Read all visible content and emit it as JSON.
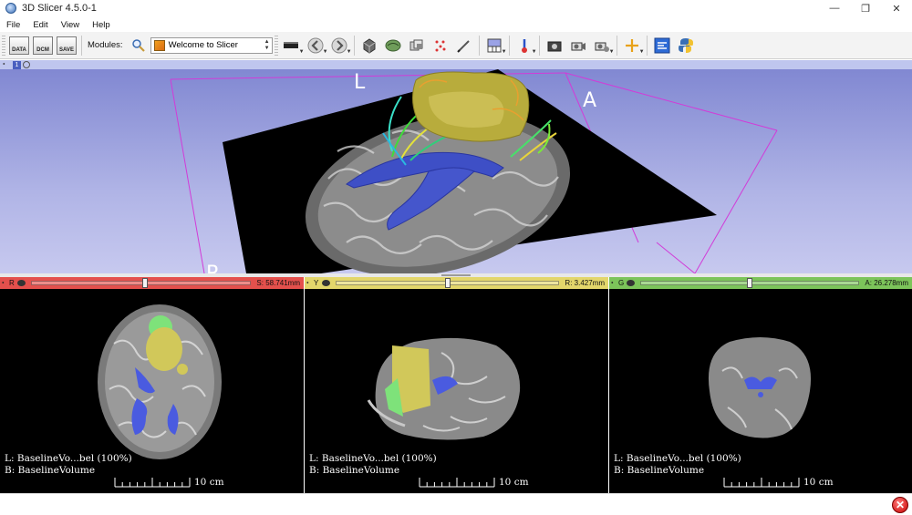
{
  "window": {
    "title": "3D Slicer 4.5.0-1",
    "minimize_glyph": "—",
    "restore_glyph": "❐",
    "close_glyph": "✕"
  },
  "menu": [
    "File",
    "Edit",
    "View",
    "Help"
  ],
  "toolbar": {
    "data_label": "DATA",
    "dcm_label": "DCM",
    "save_label": "SAVE",
    "modules_label": "Modules:",
    "module_selected": "Welcome to Slicer"
  },
  "view3d": {
    "number": "1",
    "orientation_L": "L",
    "orientation_A": "A",
    "orientation_R_partial": "R"
  },
  "slices": [
    {
      "id": "red",
      "letter": "R",
      "bar_color": "#e4504c",
      "offset": "S: 58.741mm",
      "slider_fraction": 0.52,
      "label_line": "L: BaselineVo...bel (100%)",
      "background_line": "B: BaselineVolume",
      "scale_label": "10 cm"
    },
    {
      "id": "yellow",
      "letter": "Y",
      "bar_color": "#e3d66b",
      "offset": "R: 3.427mm",
      "slider_fraction": 0.5,
      "label_line": "L: BaselineVo...bel (100%)",
      "background_line": "B: BaselineVolume",
      "scale_label": "10 cm"
    },
    {
      "id": "green",
      "letter": "G",
      "bar_color": "#7cc45a",
      "offset": "A: 26.278mm",
      "slider_fraction": 0.5,
      "label_line": "L: BaselineVo...bel (100%)",
      "background_line": "B: BaselineVolume",
      "scale_label": "10 cm"
    }
  ],
  "status": {
    "error_glyph": "✕"
  }
}
